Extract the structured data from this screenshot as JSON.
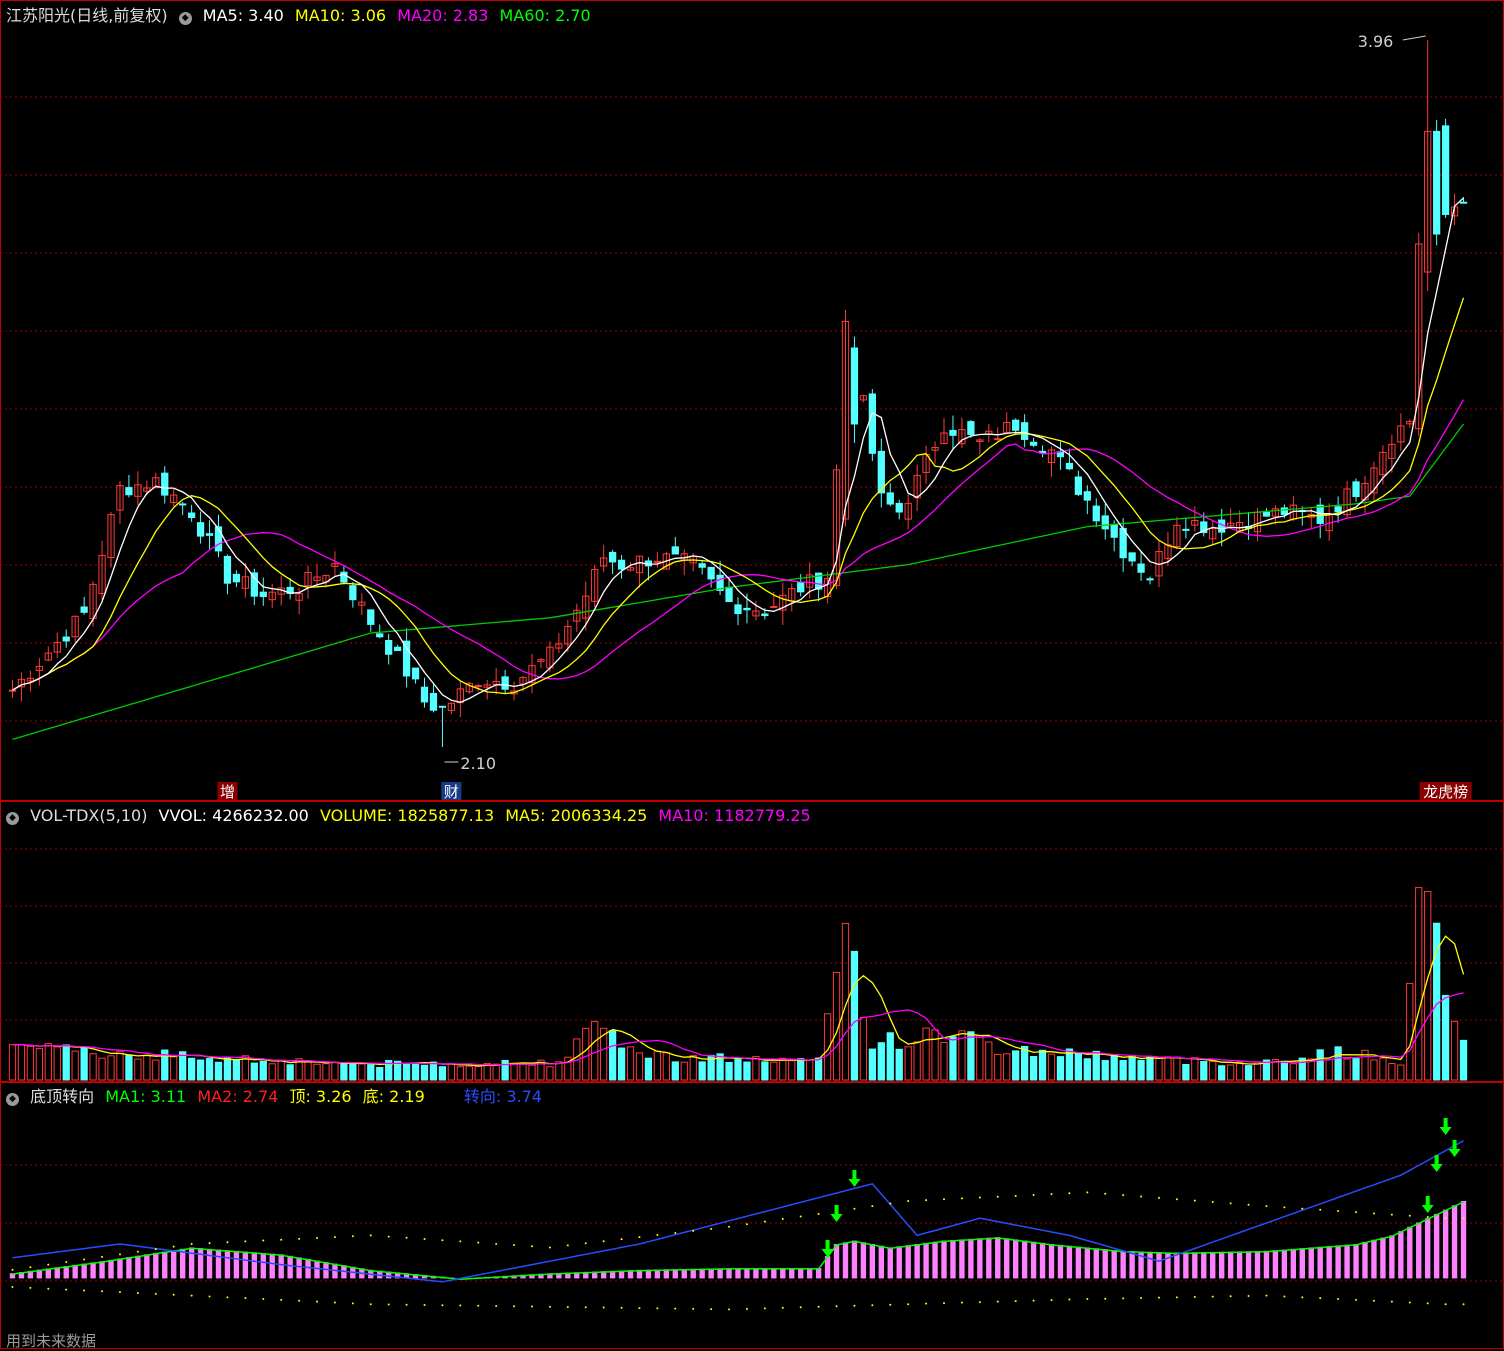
{
  "colors": {
    "up": "#ff3a3a",
    "down": "#54ffff",
    "ma5": "#ffffff",
    "ma10": "#ffff00",
    "ma20": "#ff00ff",
    "ma60": "#00cc00",
    "blue": "#2b4bff",
    "grid": "#a00000",
    "divider": "#c00000",
    "pinkbar": "#ff80ff",
    "arrow": "#00ff00"
  },
  "main": {
    "title": "江苏阳光(日线,前复权)",
    "ma": [
      {
        "label": "MA5: 3.40",
        "color": "#ffffff"
      },
      {
        "label": "MA10: 3.06",
        "color": "#ffff00"
      },
      {
        "label": "MA20: 2.83",
        "color": "#ff00ff"
      },
      {
        "label": "MA60: 2.70",
        "color": "#00ff00"
      }
    ],
    "high_label": "3.96",
    "low_label": "2.10",
    "markers": [
      {
        "text": "增",
        "idx": 24,
        "bg": "#8a0000"
      },
      {
        "text": "财",
        "idx": 49,
        "bg": "#1a3a8a"
      },
      {
        "text": "龙虎榜",
        "idx": 160,
        "bg": "#8a0000"
      }
    ]
  },
  "volume": {
    "name": "VOL-TDX(5,10)",
    "items": [
      {
        "label": "VVOL: 4266232.00",
        "color": "#ffffff"
      },
      {
        "label": "VOLUME: 1825877.13",
        "color": "#ffff00"
      },
      {
        "label": "MA5: 2006334.25",
        "color": "#ffff00"
      },
      {
        "label": "MA10: 1182779.25",
        "color": "#ff00ff"
      }
    ]
  },
  "indicator": {
    "name": "底顶转向",
    "items": [
      {
        "label": "MA1: 3.11",
        "color": "#00ff00"
      },
      {
        "label": "MA2: 2.74",
        "color": "#ff2020"
      },
      {
        "label": "顶: 3.26",
        "color": "#ffff00"
      },
      {
        "label": "底: 2.19",
        "color": "#ffff00"
      },
      {
        "label": "转向: 3.74",
        "color": "#2b4bff"
      }
    ]
  },
  "footer": "用到未来数据",
  "chart_data": {
    "type": "candlestick",
    "n_bars": 163,
    "price_range": [
      2.0,
      4.0
    ],
    "anchors": {
      "close": [
        [
          0,
          2.25
        ],
        [
          8,
          2.45
        ],
        [
          12,
          2.78
        ],
        [
          16,
          2.8
        ],
        [
          20,
          2.72
        ],
        [
          24,
          2.55
        ],
        [
          28,
          2.5
        ],
        [
          32,
          2.52
        ],
        [
          36,
          2.58
        ],
        [
          40,
          2.43
        ],
        [
          44,
          2.3
        ],
        [
          46,
          2.22
        ],
        [
          48,
          2.2
        ],
        [
          52,
          2.28
        ],
        [
          56,
          2.27
        ],
        [
          60,
          2.34
        ],
        [
          64,
          2.5
        ],
        [
          66,
          2.6
        ],
        [
          68,
          2.58
        ],
        [
          72,
          2.6
        ],
        [
          76,
          2.58
        ],
        [
          80,
          2.48
        ],
        [
          84,
          2.46
        ],
        [
          88,
          2.52
        ],
        [
          91,
          2.55
        ],
        [
          93,
          3.1
        ],
        [
          95,
          3.0
        ],
        [
          97,
          2.75
        ],
        [
          99,
          2.72
        ],
        [
          101,
          2.8
        ],
        [
          104,
          2.95
        ],
        [
          108,
          2.9
        ],
        [
          112,
          2.95
        ],
        [
          116,
          2.88
        ],
        [
          120,
          2.75
        ],
        [
          124,
          2.62
        ],
        [
          127,
          2.55
        ],
        [
          130,
          2.7
        ],
        [
          134,
          2.68
        ],
        [
          138,
          2.7
        ],
        [
          142,
          2.72
        ],
        [
          146,
          2.7
        ],
        [
          150,
          2.78
        ],
        [
          154,
          2.92
        ],
        [
          156,
          2.96
        ],
        [
          158,
          3.9
        ],
        [
          160,
          3.5
        ],
        [
          162,
          3.55
        ]
      ],
      "vol": [
        [
          0,
          1.5
        ],
        [
          8,
          1.5
        ],
        [
          20,
          1.2
        ],
        [
          40,
          0.8
        ],
        [
          60,
          0.9
        ],
        [
          66,
          2.8
        ],
        [
          70,
          1.3
        ],
        [
          90,
          0.9
        ],
        [
          93,
          9
        ],
        [
          94,
          6
        ],
        [
          96,
          2
        ],
        [
          100,
          2
        ],
        [
          105,
          2.5
        ],
        [
          110,
          1.6
        ],
        [
          120,
          1.3
        ],
        [
          130,
          1.0
        ],
        [
          140,
          0.9
        ],
        [
          148,
          1.4
        ],
        [
          155,
          1.0
        ],
        [
          157,
          8
        ],
        [
          158,
          12
        ],
        [
          160,
          5
        ],
        [
          162,
          2.3
        ]
      ],
      "ma60": [
        [
          0,
          2.12
        ],
        [
          40,
          2.4
        ],
        [
          60,
          2.44
        ],
        [
          80,
          2.52
        ],
        [
          100,
          2.58
        ],
        [
          120,
          2.68
        ],
        [
          140,
          2.72
        ],
        [
          150,
          2.74
        ],
        [
          156,
          2.76
        ],
        [
          162,
          2.95
        ]
      ],
      "ind": [
        [
          0,
          0.03
        ],
        [
          10,
          0.1
        ],
        [
          20,
          0.18
        ],
        [
          30,
          0.14
        ],
        [
          40,
          0.05
        ],
        [
          50,
          0.0
        ],
        [
          60,
          0.03
        ],
        [
          70,
          0.05
        ],
        [
          80,
          0.06
        ],
        [
          90,
          0.06
        ],
        [
          92,
          0.2
        ],
        [
          94,
          0.22
        ],
        [
          98,
          0.18
        ],
        [
          104,
          0.22
        ],
        [
          110,
          0.24
        ],
        [
          116,
          0.2
        ],
        [
          124,
          0.16
        ],
        [
          130,
          0.15
        ],
        [
          140,
          0.16
        ],
        [
          150,
          0.2
        ],
        [
          154,
          0.25
        ],
        [
          158,
          0.35
        ],
        [
          162,
          0.45
        ]
      ],
      "blue": [
        [
          0,
          0.12
        ],
        [
          12,
          0.2
        ],
        [
          30,
          0.08
        ],
        [
          48,
          -0.02
        ],
        [
          70,
          0.2
        ],
        [
          96,
          0.55
        ],
        [
          101,
          0.25
        ],
        [
          108,
          0.35
        ],
        [
          118,
          0.25
        ],
        [
          128,
          0.1
        ],
        [
          155,
          0.6
        ],
        [
          162,
          0.8
        ]
      ],
      "top": [
        [
          0,
          0.05
        ],
        [
          20,
          0.2
        ],
        [
          40,
          0.25
        ],
        [
          60,
          0.18
        ],
        [
          80,
          0.3
        ],
        [
          100,
          0.45
        ],
        [
          120,
          0.5
        ],
        [
          140,
          0.42
        ],
        [
          160,
          0.35
        ]
      ],
      "bottom": [
        [
          0,
          -0.05
        ],
        [
          40,
          -0.15
        ],
        [
          80,
          -0.18
        ],
        [
          120,
          -0.12
        ],
        [
          140,
          -0.1
        ],
        [
          160,
          -0.15
        ]
      ]
    }
  }
}
